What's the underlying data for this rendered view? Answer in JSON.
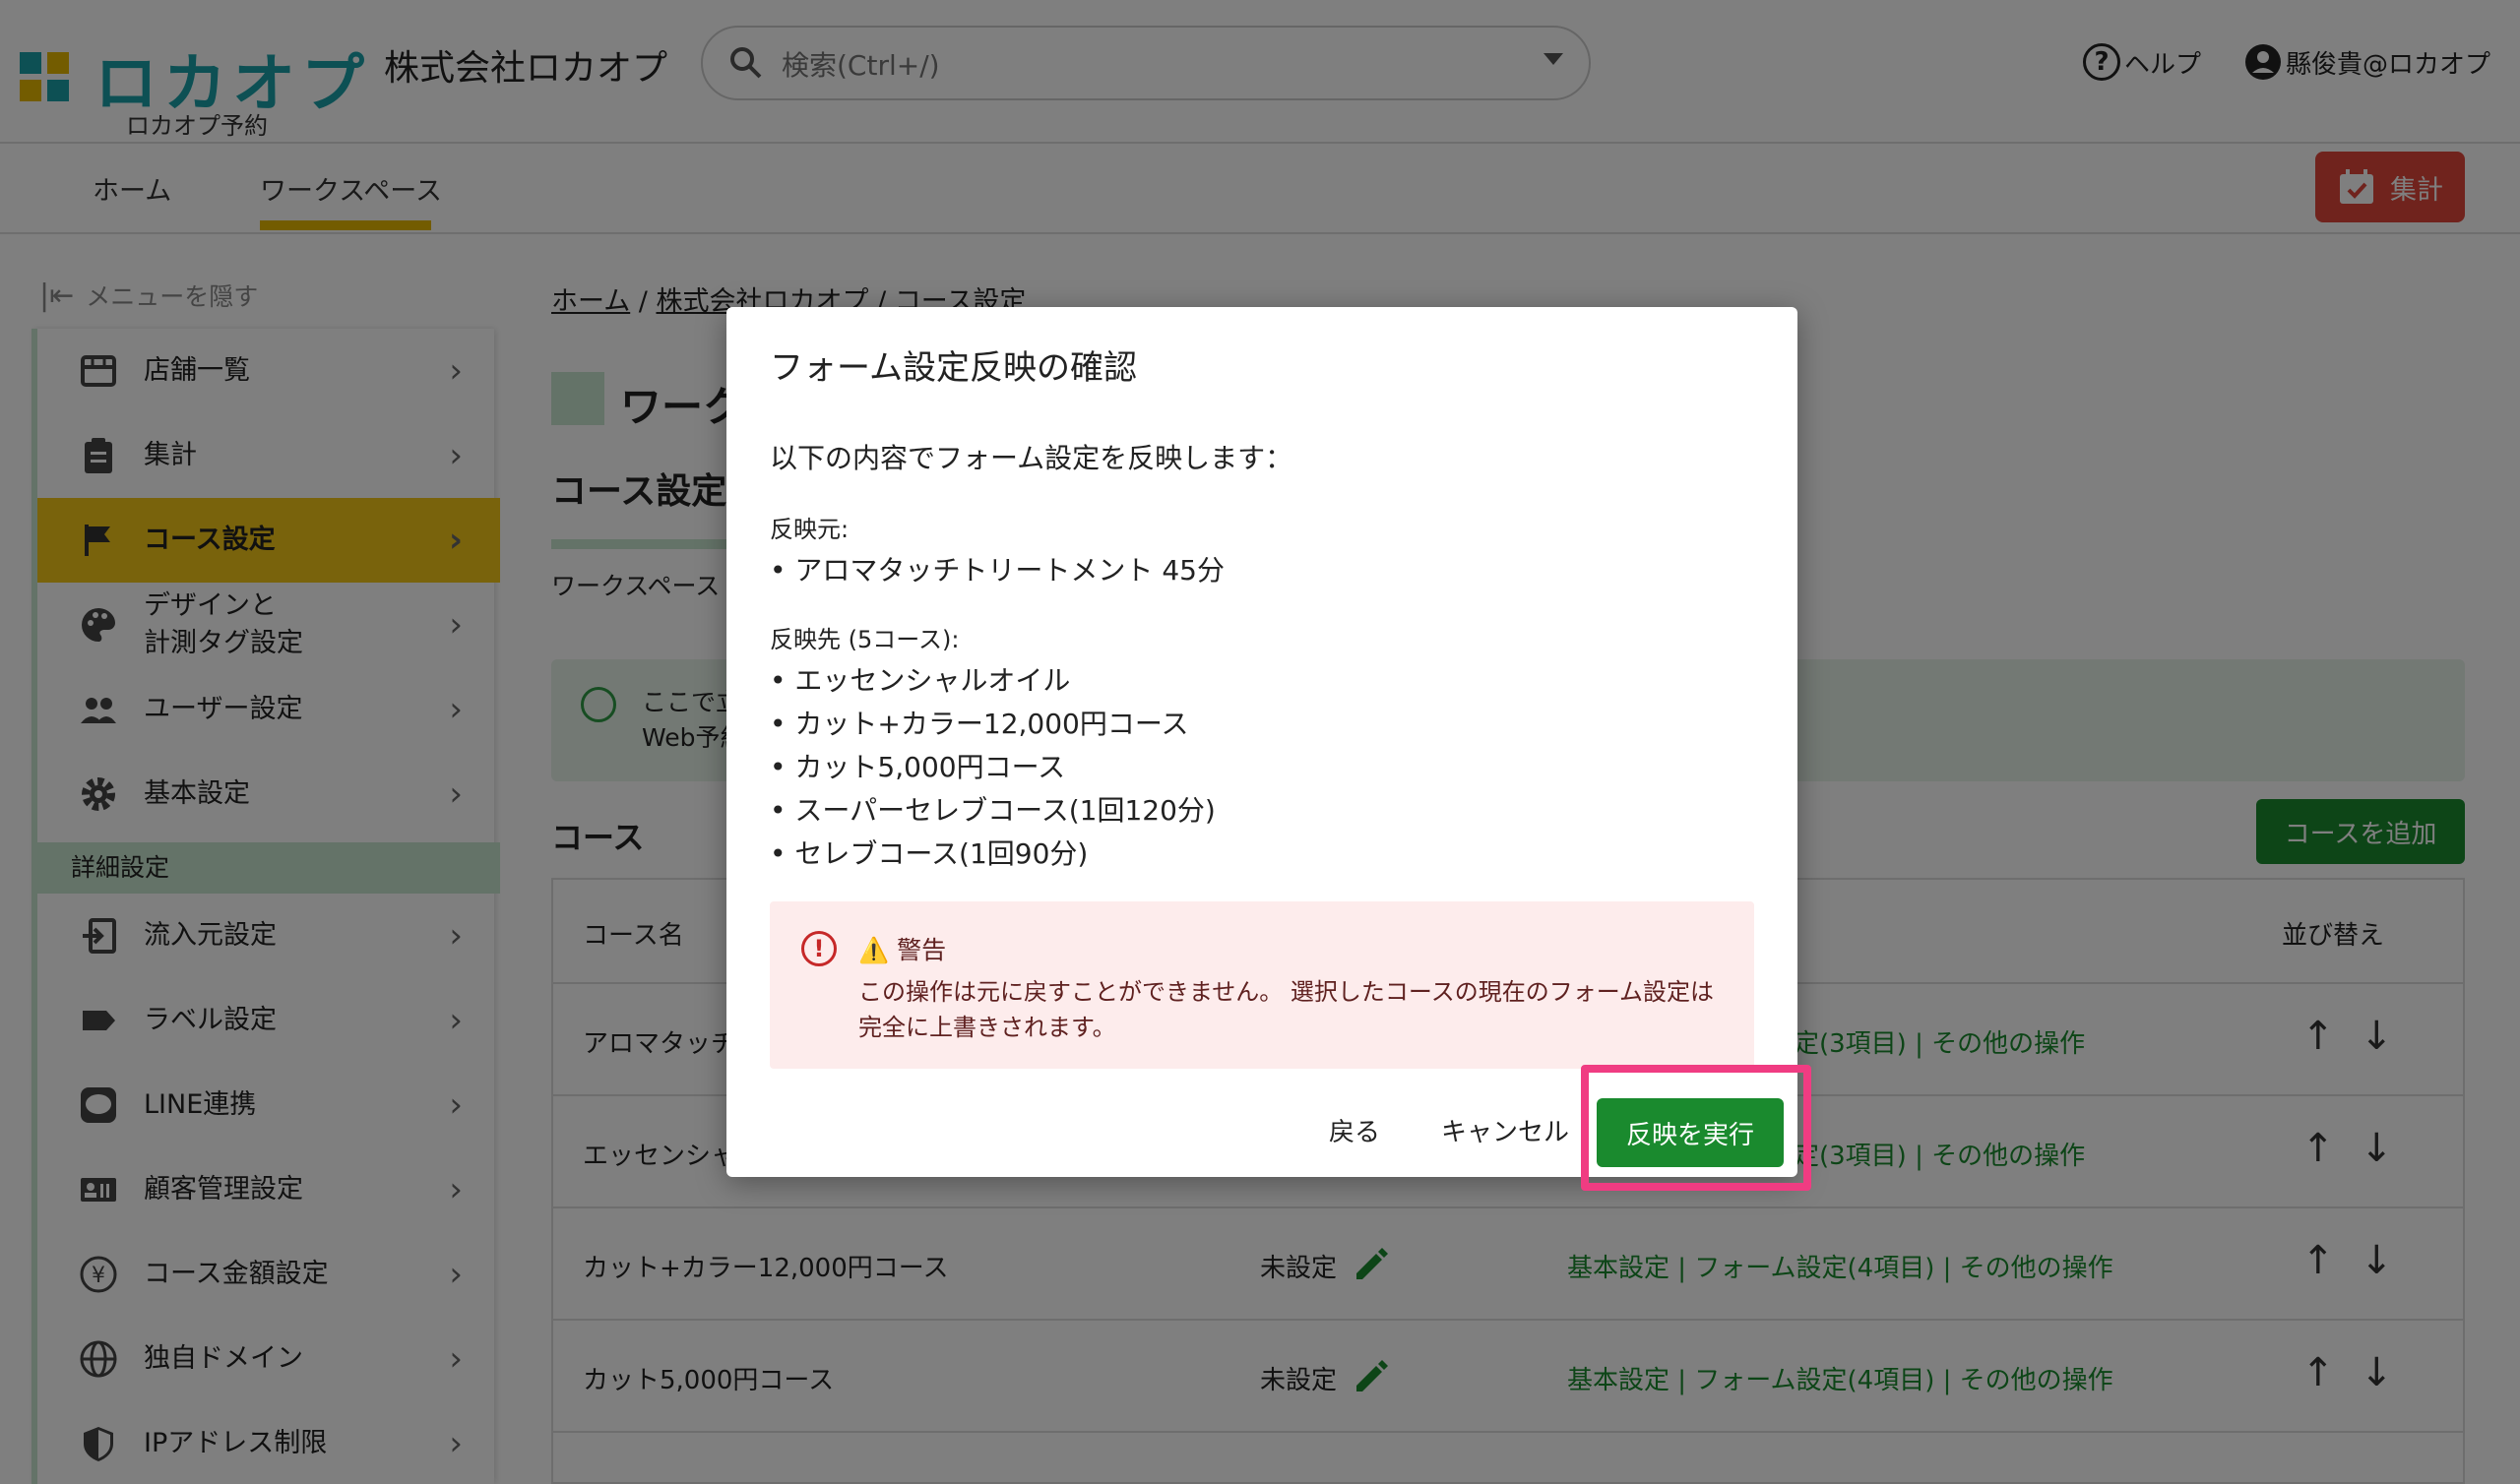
{
  "header": {
    "logo_text": "ロカオプ",
    "logo_sub": "ロカオプ予約",
    "company": "株式会社ロカオプ",
    "search_placeholder": "検索(Ctrl+/)",
    "help": "ヘルプ",
    "user": "縣俊貴@ロカオプ"
  },
  "nav": {
    "tabs": [
      {
        "label": "ホーム"
      },
      {
        "label": "ワークスペース"
      }
    ],
    "tally_button": "集計"
  },
  "sidebar": {
    "hide_menu": "メニューを隠す",
    "items": [
      {
        "label": "店舗一覧",
        "icon": "store-icon"
      },
      {
        "label": "集計",
        "icon": "clipboard-icon"
      },
      {
        "label": "コース設定",
        "icon": "flag-icon"
      },
      {
        "label": "デザインと\n計測タグ設定",
        "icon": "palette-icon"
      },
      {
        "label": "ユーザー設定",
        "icon": "people-icon"
      },
      {
        "label": "基本設定",
        "icon": "gear-icon"
      }
    ],
    "section": "詳細設定",
    "detail_items": [
      {
        "label": "流入元設定",
        "icon": "login-icon"
      },
      {
        "label": "ラベル設定",
        "icon": "label-icon"
      },
      {
        "label": "LINE連携",
        "icon": "line-icon"
      },
      {
        "label": "顧客管理設定",
        "icon": "badge-icon"
      },
      {
        "label": "コース金額設定",
        "icon": "yen-icon"
      },
      {
        "label": "独自ドメイン",
        "icon": "globe-icon"
      },
      {
        "label": "IPアドレス制限",
        "icon": "shield-icon"
      }
    ]
  },
  "main": {
    "breadcrumb": [
      "ホーム",
      "株式会社ロカオプ",
      "コース設定"
    ],
    "ws_title": "ワーク",
    "course_title": "コース設定",
    "ws_line": "ワークスペース",
    "info_line1": "ここで立",
    "info_line2": "Web予約",
    "courses_heading": "コース",
    "add_button": "コースを追加",
    "table": {
      "col_name": "コース名",
      "col_sort": "並び替え",
      "rows": [
        {
          "name": "アロマタッチ",
          "price": "",
          "links": "定(3項目) |  その他の操作"
        },
        {
          "name": "エッセンシャ",
          "price": "",
          "links": "定(3項目) |  その他の操作"
        },
        {
          "name": "カット+カラー12,000円コース",
          "price": "未設定",
          "links": "基本設定 | フォーム設定(4項目) |  その他の操作"
        },
        {
          "name": "カット5,000円コース",
          "price": "未設定",
          "links": "基本設定 | フォーム設定(4項目) |  その他の操作"
        }
      ]
    }
  },
  "modal": {
    "title": "フォーム設定反映の確認",
    "intro": "以下の内容でフォーム設定を反映します：",
    "source_label": "反映元:",
    "source_item": "• アロマタッチトリートメント 45分",
    "target_label": "反映先 (5コース):",
    "targets": [
      "• エッセンシャルオイル",
      "• カット+カラー12,000円コース",
      "• カット5,000円コース",
      "• スーパーセレブコース(1回120分)",
      "• セレブコース(1回90分)"
    ],
    "warning_title": "⚠️ 警告",
    "warning_text": "この操作は元に戻すことができません。 選択したコースの現在のフォーム設定は完全に上書きされます。",
    "back": "戻る",
    "cancel": "キャンセル",
    "execute": "反映を実行"
  }
}
